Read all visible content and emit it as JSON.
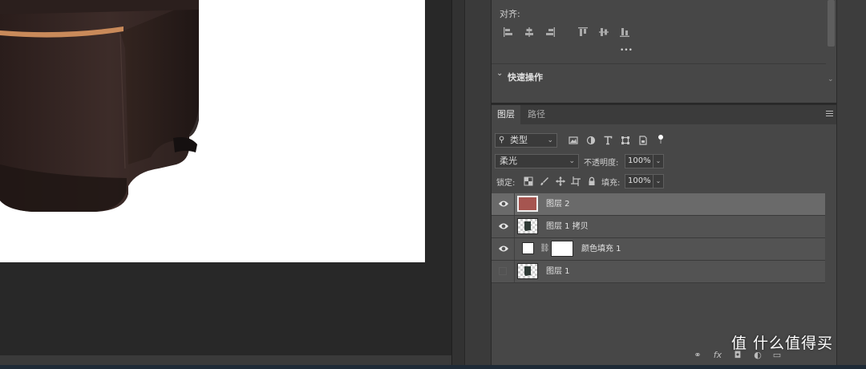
{
  "properties": {
    "align_title": "对齐:",
    "more_label": "•••",
    "quick_actions_title": "快速操作"
  },
  "layers_panel": {
    "tabs": [
      {
        "label": "图层"
      },
      {
        "label": "路径"
      }
    ],
    "filter": {
      "label": "类型"
    },
    "blend_mode": {
      "value": "柔光"
    },
    "opacity": {
      "label": "不透明度:",
      "value": "100%"
    },
    "lock": {
      "label": "锁定:"
    },
    "fill": {
      "label": "填充:",
      "value": "100%"
    },
    "layers": [
      {
        "name": "图层 2",
        "visible": true,
        "selected": true,
        "thumb_color": "#a65550"
      },
      {
        "name": "图层 1 拷贝",
        "visible": true,
        "selected": false
      },
      {
        "name": "颜色填充 1",
        "visible": true,
        "selected": false
      },
      {
        "name": "图层 1",
        "visible": false,
        "selected": false
      }
    ]
  },
  "footer": {
    "fx_label": "fx"
  },
  "watermark": {
    "text": "值 什么值得买"
  },
  "colors": {
    "product_body": "#3a2a27",
    "copper_band": "#c98a5a",
    "accent_layer": "#a65550"
  }
}
